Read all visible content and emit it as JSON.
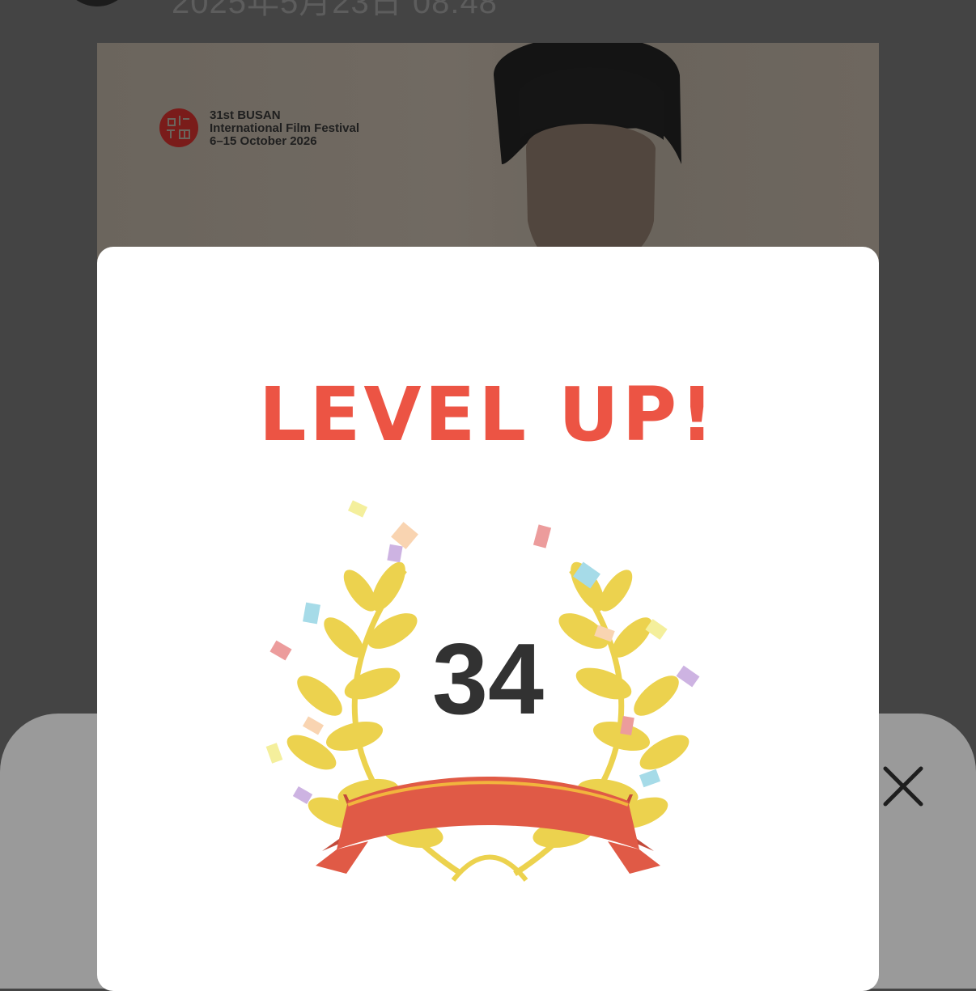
{
  "background_post": {
    "timestamp_partial": "2025年5月23日 08:48",
    "poster": {
      "edition": "31st BUSAN",
      "festival": "International Film Festival",
      "dates": "6–15 October 2026"
    }
  },
  "modal": {
    "title": "LEVEL UP!",
    "level": "34"
  },
  "colors": {
    "title": "#ec5444",
    "laurel": "#ecd24e",
    "ribbon": "#e05a46",
    "dim_overlay": "#444444",
    "sheet": "#9a9a9a"
  },
  "icons": {
    "close": "close-icon",
    "laurel": "laurel-wreath-icon",
    "festival_logo": "festival-logo-icon"
  }
}
